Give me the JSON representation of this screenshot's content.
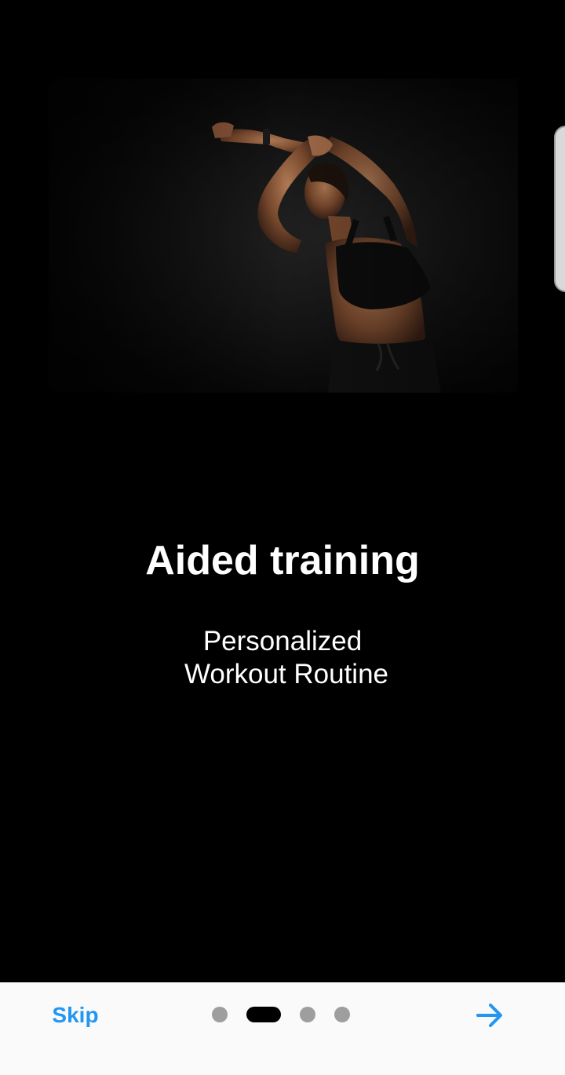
{
  "onboarding": {
    "hero_image": "woman-stretching-photo",
    "title": "Aided training",
    "subtitle_line1": "Personalized",
    "subtitle_line2": "Workout Routine"
  },
  "bottom_bar": {
    "skip_label": "Skip",
    "page_count": 4,
    "current_page": 2,
    "next_icon": "arrow-right-icon"
  },
  "colors": {
    "background": "#000000",
    "accent": "#2196f3",
    "dot_inactive": "#9e9e9e",
    "dot_active": "#000000",
    "bar_background": "#fafafa"
  }
}
